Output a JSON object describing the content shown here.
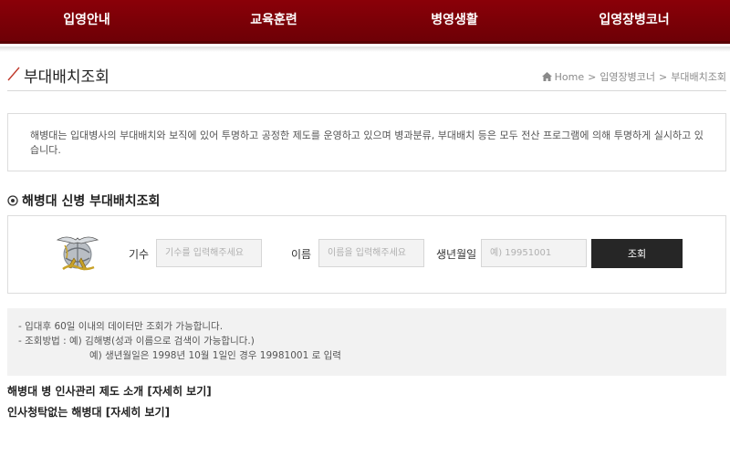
{
  "nav": {
    "items": [
      {
        "label": "입영안내"
      },
      {
        "label": "교육훈련"
      },
      {
        "label": "병영생활"
      },
      {
        "label": "입영장병코너"
      }
    ]
  },
  "header": {
    "title": "부대배치조회",
    "breadcrumb": [
      "Home",
      "입영장병코너",
      "부대배치조회"
    ],
    "breadcrumb_sep": ">"
  },
  "intro": {
    "text": "해병대는 입대병사의 부대배치와 보직에 있어 투명하고 공정한 제도를 운영하고 있으며 병과분류, 부대배치 등은 모두 전산 프로그램에 의해 투명하게 실시하고 있습니다."
  },
  "search": {
    "title": "해병대 신병 부대배치조회",
    "cohort_label": "기수",
    "cohort_placeholder": "기수를 입력해주세요",
    "name_label": "이름",
    "name_placeholder": "이름을 입력해주세요",
    "birth_label": "생년월일",
    "birth_placeholder": "예) 19951001",
    "submit_label": "조회"
  },
  "notes": [
    "- 입대후 60일 이내의 데이터만 조회가 가능합니다.",
    "- 조회방법 : 예) 김해병(성과 이름으로 검색이 가능합니다.)",
    "예) 생년월일은 1998년 10월 1일인 경우 19981001 로 입력"
  ],
  "links": [
    {
      "text": "해병대 병 인사관리 제도 소개",
      "more": "[자세히 보기]"
    },
    {
      "text": "인사청탁없는 해병대",
      "more": "[자세히 보기]"
    }
  ],
  "colors": {
    "nav_bg": "#7a0007",
    "button_bg": "#262626",
    "accent_slash": "#c0392b"
  }
}
